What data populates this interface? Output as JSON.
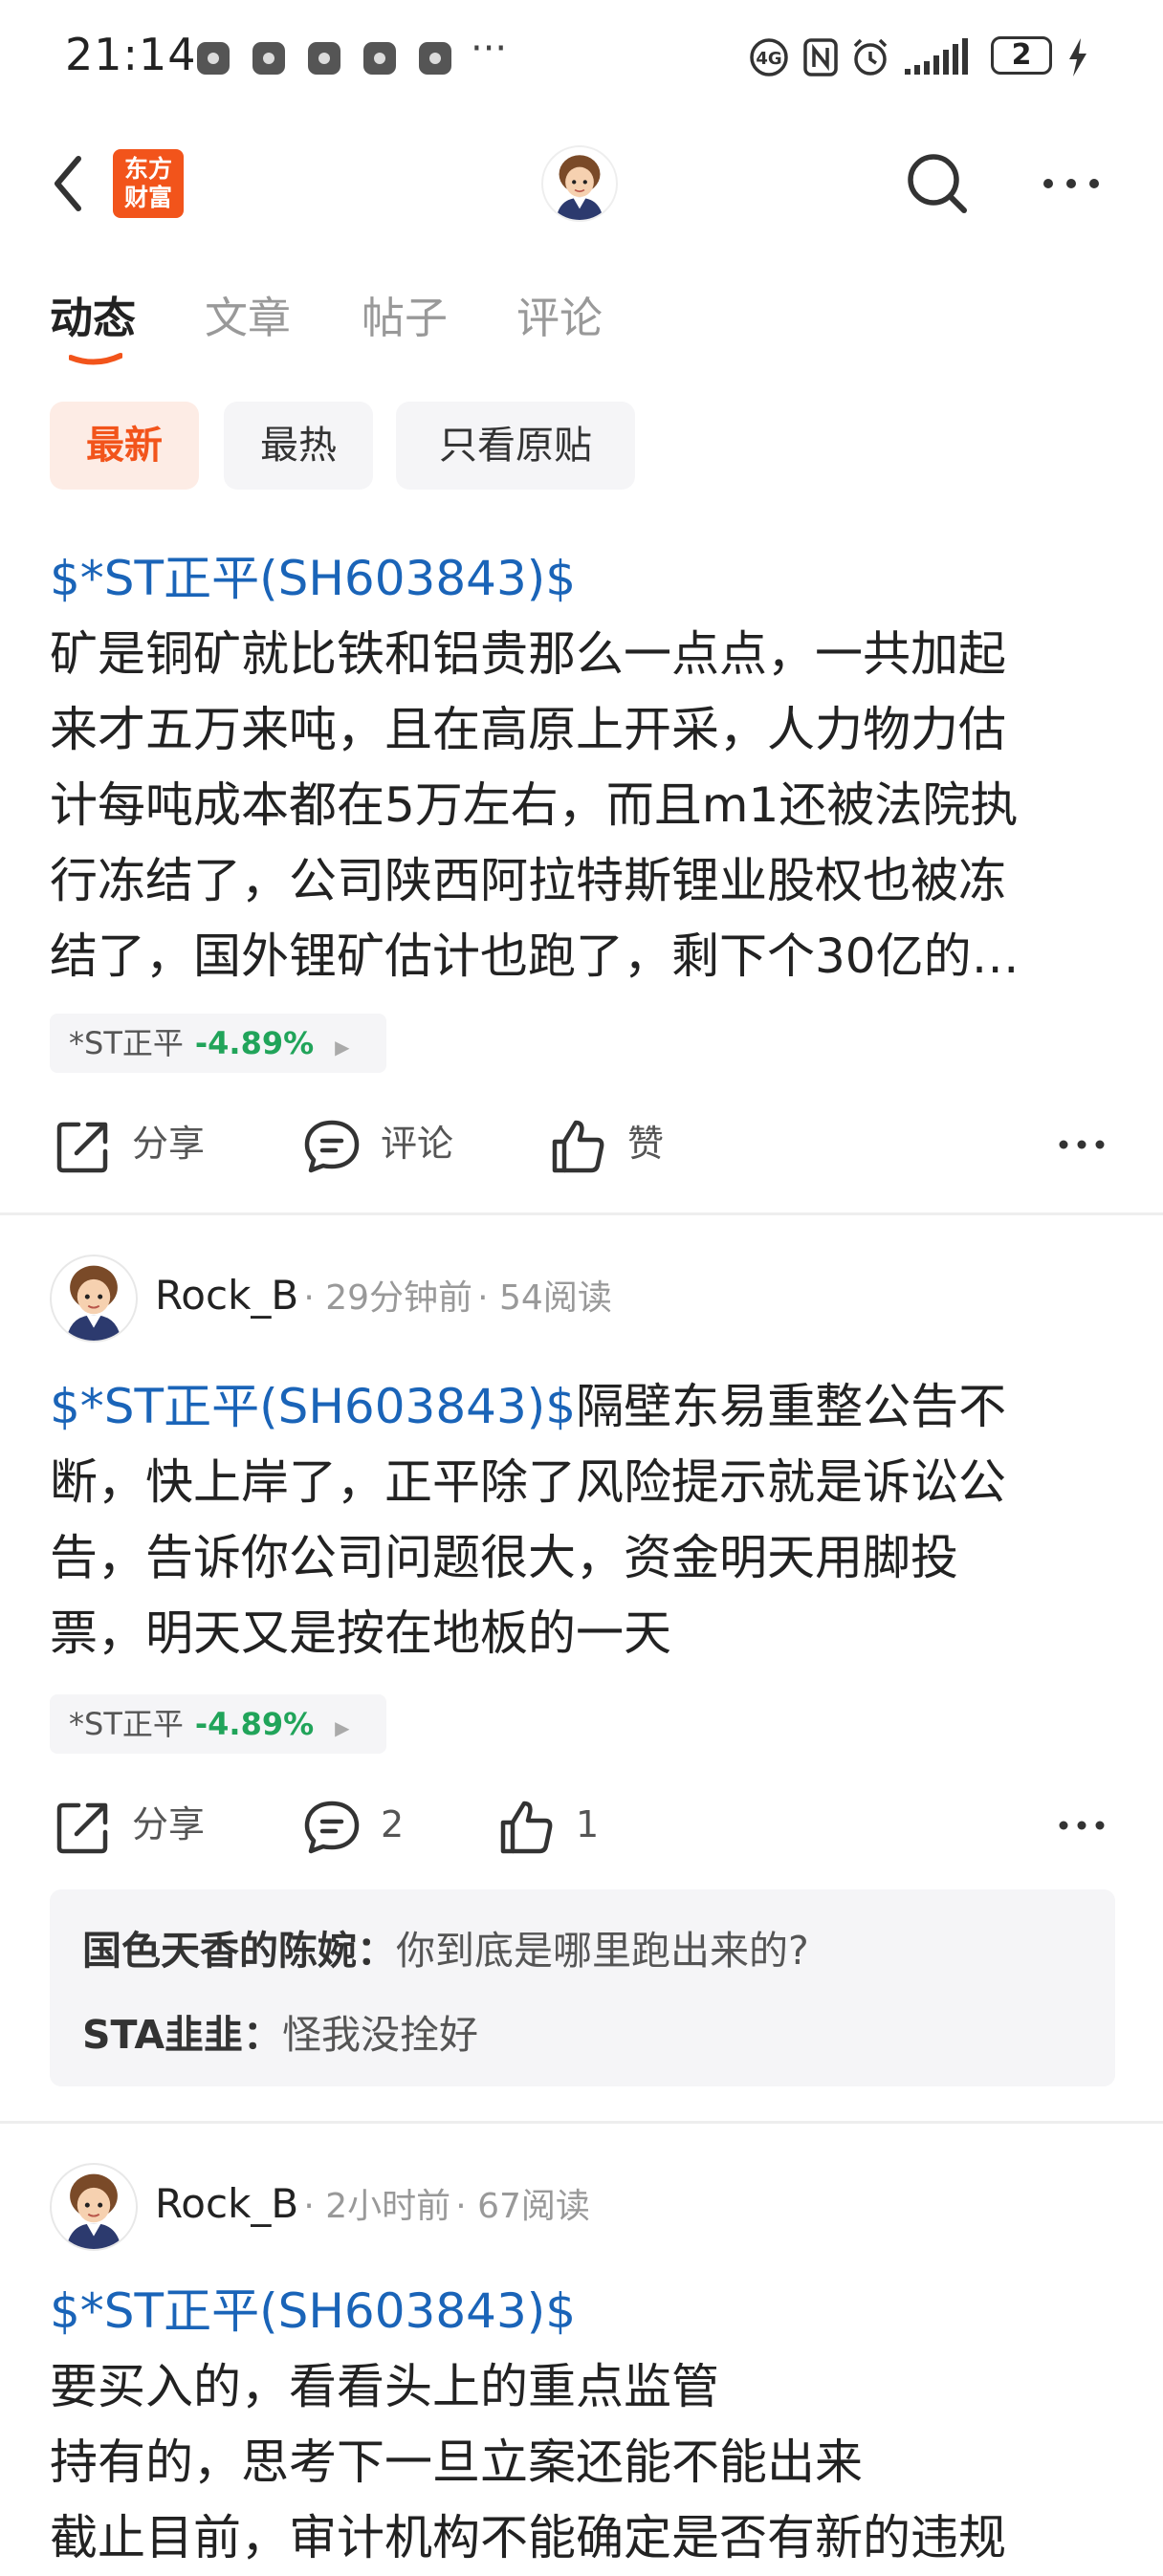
{
  "status_bar": {
    "time": "21:14",
    "more": "···",
    "battery": "2"
  },
  "header": {
    "logo_line1": "东方",
    "logo_line2": "财富"
  },
  "tabs": [
    {
      "label": "动态"
    },
    {
      "label": "文章"
    },
    {
      "label": "帖子"
    },
    {
      "label": "评论"
    }
  ],
  "filters": [
    {
      "label": "最新"
    },
    {
      "label": "最热"
    },
    {
      "label": "只看原贴"
    }
  ],
  "posts": [
    {
      "tag": "$*ST正平(SH603843)$",
      "lines": [
        "矿是铜矿就比铁和铝贵那么一点点，一共加起",
        "来才五万来吨，且在高原上开采，人力物力估",
        "计每吨成本都在5万左右，而且m1还被法院执",
        "行冻结了，公司陕西阿拉特斯锂业股权也被冻",
        "结了，国外锂矿估计也跑了，剩下个30亿的…"
      ],
      "stock": {
        "name": "*ST正平",
        "change": "-4.89%"
      },
      "actions": {
        "share": "分享",
        "comment": "评论",
        "like": "赞"
      }
    },
    {
      "author": "Rock_B",
      "time": "29分钟前",
      "reads": "54阅读",
      "tag": "$*ST正平(SH603843)$",
      "first_line_rest": "隔壁东易重整公告不",
      "lines": [
        "断，快上岸了，正平除了风险提示就是诉讼公",
        "告，告诉你公司问题很大，资金明天用脚投",
        "票，明天又是按在地板的一天"
      ],
      "stock": {
        "name": "*ST正平",
        "change": "-4.89%"
      },
      "actions": {
        "share": "分享",
        "comment": "2",
        "like": "1"
      },
      "comments": [
        {
          "user": "国色天香的陈婉：",
          "text": "你到底是哪里跑出来的?"
        },
        {
          "user": "STA韭韭：",
          "text": "怪我没拴好"
        }
      ]
    },
    {
      "author": "Rock_B",
      "time": "2小时前",
      "reads": "67阅读",
      "tag": "$*ST正平(SH603843)$",
      "lines": [
        "要买入的，看看头上的重点监管",
        "持有的，思考下一旦立案还能不能出来",
        "截止目前，审计机构不能确定是否有新的违规"
      ]
    }
  ],
  "colors": {
    "accent": "#f2541b",
    "link": "#1a64b8",
    "down": "#21a45a"
  }
}
